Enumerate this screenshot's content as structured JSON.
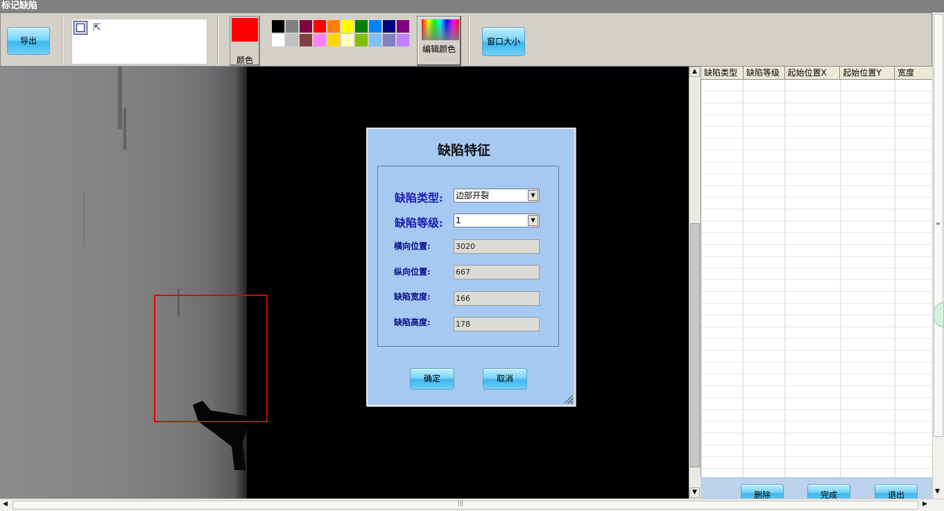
{
  "window": {
    "title": "标记缺陷"
  },
  "toolbar": {
    "export_label": "导出",
    "color_label": "颜色",
    "edit_colors_label": "编辑颜色",
    "window_size_label": "窗口大小",
    "current_color": "#ff0000",
    "palette": [
      "#000000",
      "#808080",
      "#800040",
      "#ff0000",
      "#ff8000",
      "#ffff00",
      "#008000",
      "#0080ff",
      "#000080",
      "#800080",
      "#ffffff",
      "#c0c0c0",
      "#804040",
      "#ff80ff",
      "#ffd700",
      "#ffffc0",
      "#80c000",
      "#80c0ff",
      "#8080c0",
      "#c080ff",
      "#d4d0c8",
      "#d4d0c8",
      "#d4d0c8",
      "#d4d0c8",
      "#d4d0c8",
      "#d4d0c8",
      "#d4d0c8",
      "#d4d0c8",
      "#d4d0c8",
      "#d4d0c8"
    ]
  },
  "table": {
    "columns": [
      "缺陷类型",
      "缺陷等级",
      "起始位置X",
      "起始位置Y",
      "宽度"
    ],
    "rows": []
  },
  "footer": {
    "delete_label": "删除",
    "finish_label": "完成",
    "exit_label": "退出"
  },
  "dialog": {
    "title": "缺陷特征",
    "defect_type_label": "缺陷类型:",
    "defect_type_value": "边部开裂",
    "defect_level_label": "缺陷等级:",
    "defect_level_value": "1",
    "horizontal_pos_label": "横向位置:",
    "horizontal_pos_value": "3020",
    "vertical_pos_label": "纵向位置:",
    "vertical_pos_value": "667",
    "width_label": "缺陷宽度:",
    "width_value": "166",
    "height_label": "缺陷高度:",
    "height_value": "178",
    "ok_label": "确定",
    "cancel_label": "取消"
  }
}
